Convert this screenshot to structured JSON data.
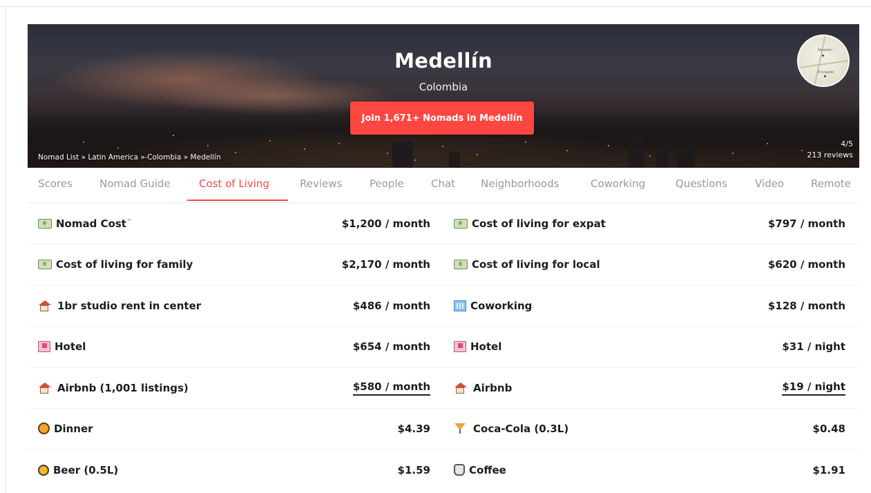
{
  "hero": {
    "city": "Medellín",
    "country": "Colombia",
    "join_button": "Join 1,671+ Nomads in Medellín",
    "breadcrumb": "Nomad List » Latin America » Colombia » Medellín",
    "rating": "4/5",
    "reviews": "213 reviews",
    "map_labels": [
      "Medellín",
      "Envigado"
    ]
  },
  "tabs": [
    {
      "label": "Scores"
    },
    {
      "label": "Nomad Guide"
    },
    {
      "label": "Cost of Living",
      "active": true
    },
    {
      "label": "Reviews"
    },
    {
      "label": "People"
    },
    {
      "label": "Chat"
    },
    {
      "label": "Neighborhoods"
    },
    {
      "label": "Coworking"
    },
    {
      "label": "Questions"
    },
    {
      "label": "Video"
    },
    {
      "label": "Remote"
    }
  ],
  "costs": {
    "left": [
      {
        "icon": "money-bill-icon",
        "label": "Nomad Cost",
        "sup": "™",
        "value": "$1,200 / month"
      },
      {
        "icon": "money-bill-icon",
        "label": "Cost of living for family",
        "value": "$2,170 / month"
      },
      {
        "icon": "house-icon",
        "label": "1br studio rent in center",
        "value": "$486 / month"
      },
      {
        "icon": "hotel-icon",
        "label": "Hotel",
        "value": "$654 / month"
      },
      {
        "icon": "house-icon",
        "label": "Airbnb (1,001 listings)",
        "value": "$580 / month",
        "link": true
      },
      {
        "icon": "food-icon",
        "label": "Dinner",
        "value": "$4.39"
      },
      {
        "icon": "beer-icon",
        "label": "Beer (0.5L)",
        "value": "$1.59"
      }
    ],
    "right": [
      {
        "icon": "money-bill-icon",
        "label": "Cost of living for expat",
        "value": "$797 / month"
      },
      {
        "icon": "money-bill-icon",
        "label": "Cost of living for local",
        "value": "$620 / month"
      },
      {
        "icon": "office-icon",
        "label": "Coworking",
        "value": "$128 / month"
      },
      {
        "icon": "hotel-icon",
        "label": "Hotel",
        "value": "$31 / night"
      },
      {
        "icon": "house-icon",
        "label": "Airbnb",
        "value": "$19 / night",
        "link": true
      },
      {
        "icon": "cocktail-icon",
        "label": "Coca-Cola (0.3L)",
        "value": "$0.48"
      },
      {
        "icon": "coffee-icon",
        "label": "Coffee",
        "value": "$1.91"
      }
    ]
  },
  "colors": {
    "accent": "#ff4742"
  }
}
